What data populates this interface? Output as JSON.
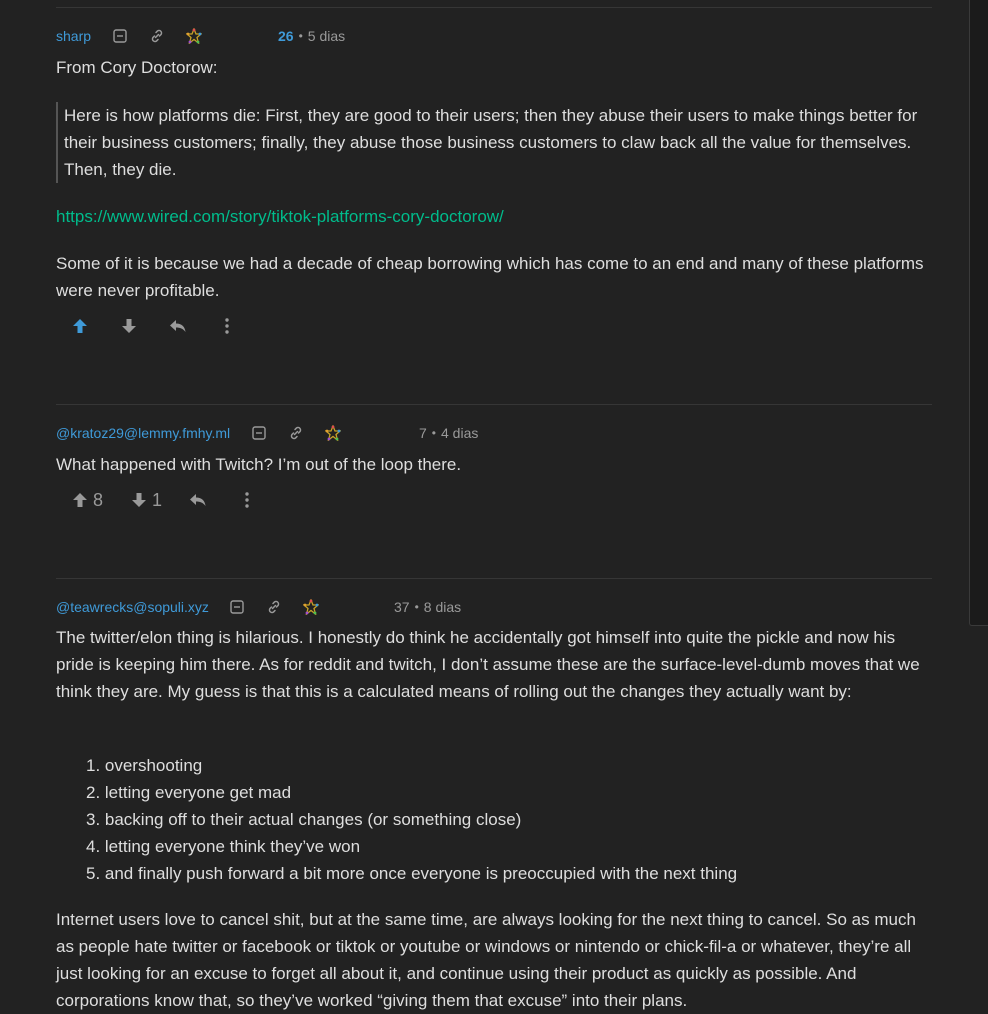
{
  "colors": {
    "background": "#222222",
    "username": "#3f9ad8",
    "link": "#00bc8c",
    "upvoted": "#3f9ad8",
    "muted": "#9a9a9a"
  },
  "comments": [
    {
      "username": "sharp",
      "score": "26",
      "score_separator": "•",
      "age": "5 dias",
      "body_intro": "From Cory Doctorow:",
      "quote": "Here is how platforms die: First, they are good to their users; then they abuse their users to make things better for their business customers; finally, they abuse those business customers to claw back all the value for themselves. Then, they die.",
      "link": "https://www.wired.com/story/tiktok-platforms-cory-doctorow/",
      "body_outro": "Some of it is because we had a decade of cheap borrowing which has come to an end and many of these platforms were never profitable.",
      "upvoted": true
    },
    {
      "username": "@kratoz29@lemmy.fmhy.ml",
      "score": "7",
      "score_separator": "•",
      "age": "4 dias",
      "body": "What happened with Twitch? I’m out of the loop there.",
      "upvotes": "8",
      "downvotes": "1"
    },
    {
      "username": "@teawrecks@sopuli.xyz",
      "score": "37",
      "score_separator": "•",
      "age": "8 dias",
      "body_intro": "The twitter/elon thing is hilarious. I honestly do think he accidentally got himself into quite the pickle and now his pride is keeping him there. As for reddit and twitch, I don’t assume these are the surface-level-dumb moves that we think they are. My guess is that this is a calculated means of rolling out the changes they actually want by:",
      "list": [
        "1. overshooting",
        "2. letting everyone get mad",
        "3. backing off to their actual changes (or something close)",
        "4. letting everyone think they’ve won",
        "5. and finally push forward a bit more once everyone is preoccupied with the next thing"
      ],
      "body_outro": "Internet users love to cancel shit, but at the same time, are always looking for the next thing to cancel. So as much as people hate twitter or facebook or tiktok or youtube or windows or nintendo or chick-fil-a or whatever, they’re all just looking for an excuse to forget all about it, and continue using their product as quickly as possible. And corporations know that, so they’ve worked “giving them that excuse” into their plans."
    }
  ],
  "icons": {
    "collapse": "collapse-icon",
    "permalink": "link-icon",
    "federated": "fediverse-icon",
    "upvote": "arrow-up-icon",
    "downvote": "arrow-down-icon",
    "reply": "reply-icon",
    "more": "more-vertical-icon"
  }
}
